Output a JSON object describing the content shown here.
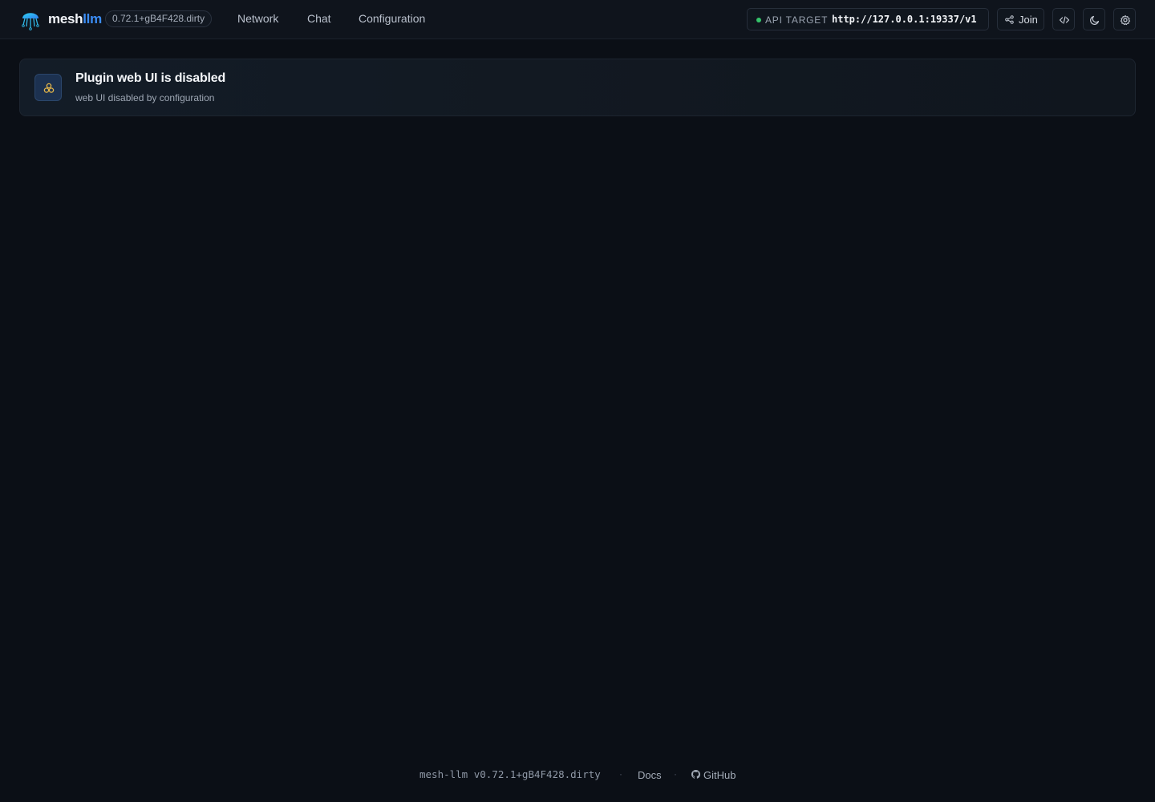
{
  "app": {
    "brand_part1": "mesh",
    "brand_part2": "llm",
    "version_badge": "0.72.1+gB4F428.dirty"
  },
  "nav": {
    "items": [
      {
        "label": "Network"
      },
      {
        "label": "Chat"
      },
      {
        "label": "Configuration"
      }
    ]
  },
  "header": {
    "api_target_label": "API TARGET",
    "api_target_url": "http://127.0.0.1:19337/v1",
    "api_status_color": "#35c46a",
    "join_label": "Join",
    "icons": [
      "share-icon",
      "code-icon",
      "moon-icon",
      "gear-icon"
    ]
  },
  "alert": {
    "title": "Plugin web UI is disabled",
    "subtitle": "web UI disabled by configuration",
    "icon": "plugin-icon",
    "icon_color": "#e9b949"
  },
  "footer": {
    "version": "mesh-llm v0.72.1+gB4F428.dirty",
    "separator": "·",
    "docs_label": "Docs",
    "github_label": "GitHub"
  },
  "colors": {
    "background": "#0b0f16",
    "accent": "#3b8df5"
  }
}
